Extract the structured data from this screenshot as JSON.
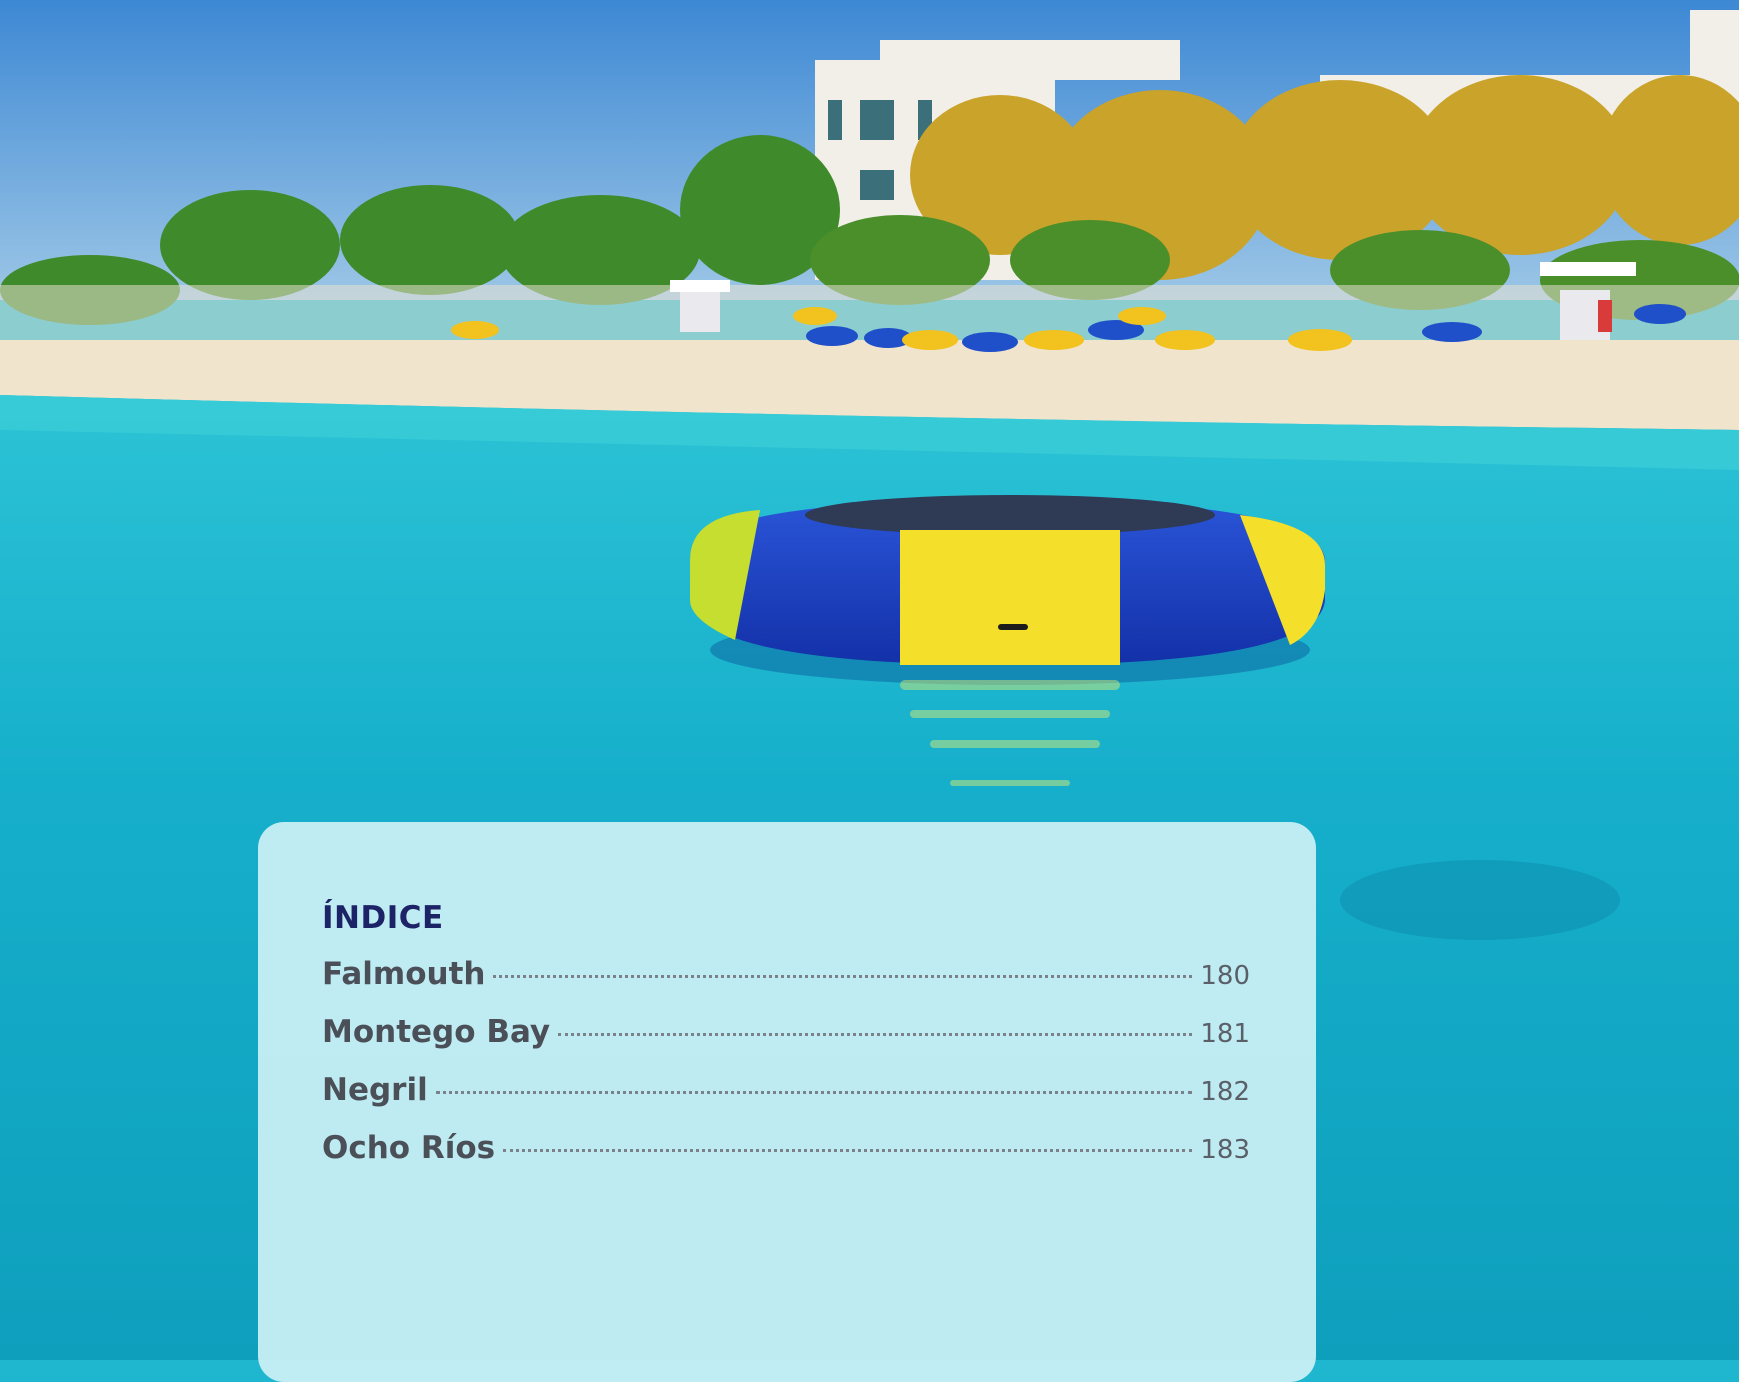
{
  "index": {
    "title": "ÍNDICE",
    "entries": [
      {
        "label": "Falmouth",
        "page": "180"
      },
      {
        "label": "Montego Bay",
        "page": "181"
      },
      {
        "label": "Negril",
        "page": "182"
      },
      {
        "label": "Ocho Ríos",
        "page": "183"
      }
    ]
  },
  "colors": {
    "title": "#1c2467",
    "text": "#4a4f58",
    "card": "#d2f3f6",
    "water": "#1fb6cf",
    "sky": "#5aa0dc"
  }
}
